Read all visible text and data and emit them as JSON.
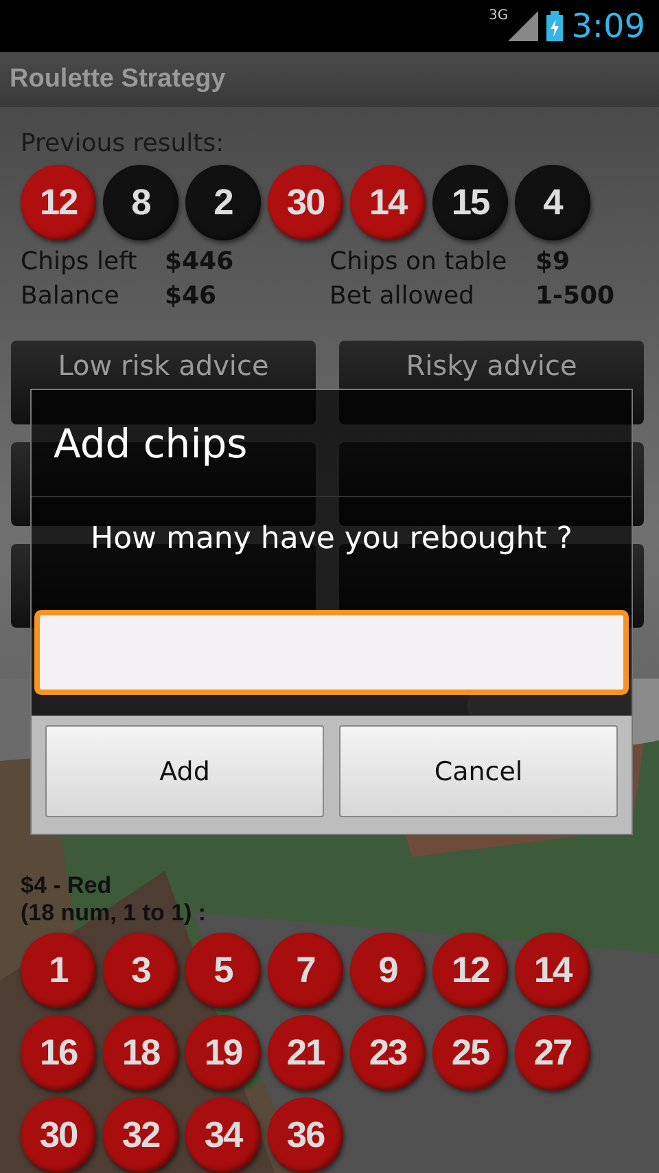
{
  "status_bar": {
    "network": "3G",
    "time": "3:09"
  },
  "app_bar": {
    "title": "Roulette Strategy"
  },
  "previous": {
    "label": "Previous results:",
    "results": [
      {
        "number": "12",
        "color": "#b00f0f"
      },
      {
        "number": "8",
        "color": "#111111"
      },
      {
        "number": "2",
        "color": "#111111"
      },
      {
        "number": "30",
        "color": "#b00f0f"
      },
      {
        "number": "14",
        "color": "#b00f0f"
      },
      {
        "number": "15",
        "color": "#111111"
      },
      {
        "number": "4",
        "color": "#111111"
      }
    ]
  },
  "stats": [
    {
      "label": "Chips left",
      "value": "$446"
    },
    {
      "label": "Chips on table",
      "value": "$9"
    },
    {
      "label": "Balance",
      "value": "$46"
    },
    {
      "label": "Bet allowed",
      "value": "1-500"
    }
  ],
  "actions": [
    "Low risk advice",
    "Risky advice"
  ],
  "bet": {
    "title": "$4 - Red",
    "subtitle": "(18 num, 1 to 1) :",
    "numbers": [
      {
        "number": "1",
        "color": "#a80e0e"
      },
      {
        "number": "3",
        "color": "#a80e0e"
      },
      {
        "number": "5",
        "color": "#a80e0e"
      },
      {
        "number": "7",
        "color": "#a80e0e"
      },
      {
        "number": "9",
        "color": "#a80e0e"
      },
      {
        "number": "12",
        "color": "#a80e0e"
      },
      {
        "number": "14",
        "color": "#a80e0e"
      },
      {
        "number": "16",
        "color": "#a80e0e"
      },
      {
        "number": "18",
        "color": "#a80e0e"
      },
      {
        "number": "19",
        "color": "#a80e0e"
      },
      {
        "number": "21",
        "color": "#a80e0e"
      },
      {
        "number": "23",
        "color": "#a80e0e"
      },
      {
        "number": "25",
        "color": "#a80e0e"
      },
      {
        "number": "27",
        "color": "#a80e0e"
      },
      {
        "number": "30",
        "color": "#a80e0e"
      },
      {
        "number": "32",
        "color": "#a80e0e"
      },
      {
        "number": "34",
        "color": "#a80e0e"
      },
      {
        "number": "36",
        "color": "#a80e0e"
      }
    ]
  },
  "dialog": {
    "title": "Add chips",
    "message": "How many have you rebought ?",
    "buttons": [
      "Add",
      "Cancel"
    ]
  }
}
